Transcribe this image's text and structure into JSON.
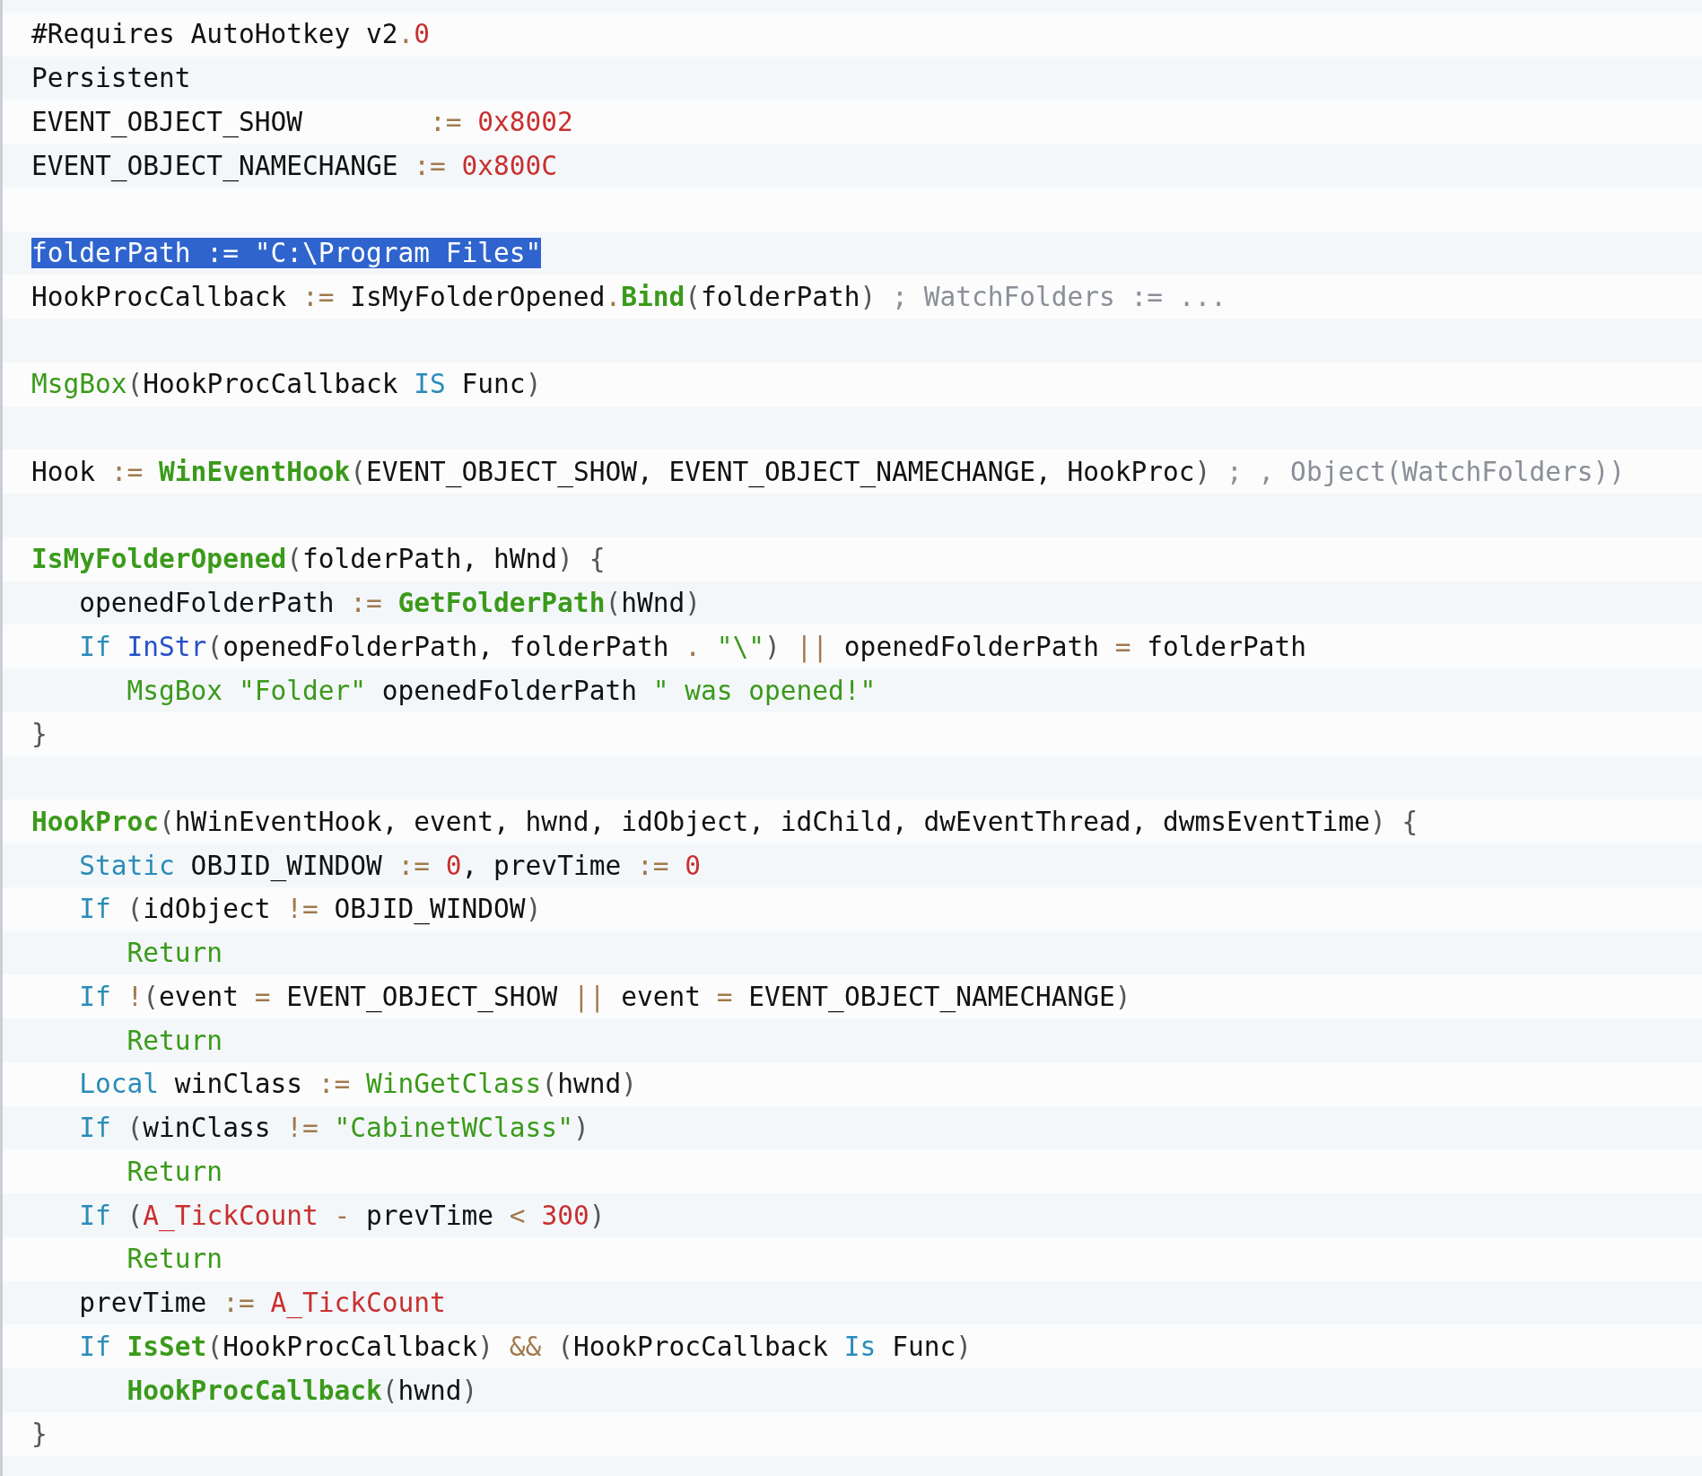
{
  "code": {
    "lines": [
      {
        "kind": "code",
        "tokens": [
          {
            "kind": "t",
            "text": "#Requires AutoHotkey v2"
          },
          {
            "kind": "o",
            "text": "."
          },
          {
            "kind": "n",
            "text": "0"
          }
        ]
      },
      {
        "kind": "code",
        "tokens": [
          {
            "kind": "t",
            "text": "Persistent"
          }
        ]
      },
      {
        "kind": "code",
        "tokens": [
          {
            "kind": "t",
            "text": "EVENT_OBJECT_SHOW       "
          },
          {
            "kind": "o",
            "text": " := "
          },
          {
            "kind": "n",
            "text": "0x8002"
          }
        ]
      },
      {
        "kind": "code",
        "tokens": [
          {
            "kind": "t",
            "text": "EVENT_OBJECT_NAMECHANGE"
          },
          {
            "kind": "o",
            "text": " := "
          },
          {
            "kind": "n",
            "text": "0x800C"
          }
        ]
      },
      {
        "kind": "blank"
      },
      {
        "kind": "code",
        "tokens": [
          {
            "kind": "h",
            "text": "folderPath := \"C:\\Program Files\""
          }
        ]
      },
      {
        "kind": "code",
        "tokens": [
          {
            "kind": "t",
            "text": "HookProcCallback"
          },
          {
            "kind": "o",
            "text": " := "
          },
          {
            "kind": "t",
            "text": "IsMyFolderOpened"
          },
          {
            "kind": "o",
            "text": "."
          },
          {
            "kind": "b",
            "text": "Bind"
          },
          {
            "kind": "p",
            "text": "("
          },
          {
            "kind": "t",
            "text": "folderPath"
          },
          {
            "kind": "p",
            "text": ")"
          },
          {
            "kind": "c",
            "text": " ; WatchFolders := ..."
          }
        ]
      },
      {
        "kind": "blank"
      },
      {
        "kind": "code",
        "tokens": [
          {
            "kind": "f",
            "text": "MsgBox"
          },
          {
            "kind": "p",
            "text": "("
          },
          {
            "kind": "t",
            "text": "HookProcCallback "
          },
          {
            "kind": "k",
            "text": "IS"
          },
          {
            "kind": "t",
            "text": " Func"
          },
          {
            "kind": "p",
            "text": ")"
          }
        ]
      },
      {
        "kind": "blank"
      },
      {
        "kind": "code",
        "tokens": [
          {
            "kind": "t",
            "text": "Hook"
          },
          {
            "kind": "o",
            "text": " := "
          },
          {
            "kind": "b",
            "text": "WinEventHook"
          },
          {
            "kind": "p",
            "text": "("
          },
          {
            "kind": "t",
            "text": "EVENT_OBJECT_SHOW, EVENT_OBJECT_NAMECHANGE, HookProc"
          },
          {
            "kind": "p",
            "text": ")"
          },
          {
            "kind": "c",
            "text": " ; , Object(WatchFolders))"
          }
        ]
      },
      {
        "kind": "blank"
      },
      {
        "kind": "code",
        "tokens": [
          {
            "kind": "b",
            "text": "IsMyFolderOpened"
          },
          {
            "kind": "p",
            "text": "("
          },
          {
            "kind": "t",
            "text": "folderPath, hWnd"
          },
          {
            "kind": "p",
            "text": ") {"
          }
        ],
        "children": [
          {
            "kind": "code",
            "tokens": [
              {
                "kind": "t",
                "text": "openedFolderPath"
              },
              {
                "kind": "o",
                "text": " := "
              },
              {
                "kind": "b",
                "text": "GetFolderPath"
              },
              {
                "kind": "p",
                "text": "("
              },
              {
                "kind": "t",
                "text": "hWnd"
              },
              {
                "kind": "p",
                "text": ")"
              }
            ]
          },
          {
            "kind": "code",
            "tokens": [
              {
                "kind": "k",
                "text": "If "
              },
              {
                "kind": "i",
                "text": "InStr"
              },
              {
                "kind": "p",
                "text": "("
              },
              {
                "kind": "t",
                "text": "openedFolderPath, folderPath"
              },
              {
                "kind": "o",
                "text": " . "
              },
              {
                "kind": "s",
                "text": "\"\\\""
              },
              {
                "kind": "p",
                "text": ")"
              },
              {
                "kind": "o",
                "text": " || "
              },
              {
                "kind": "t",
                "text": "openedFolderPath"
              },
              {
                "kind": "o",
                "text": " = "
              },
              {
                "kind": "t",
                "text": "folderPath"
              }
            ],
            "children": [
              {
                "kind": "code",
                "tokens": [
                  {
                    "kind": "f",
                    "text": "MsgBox"
                  },
                  {
                    "kind": "s",
                    "text": " \"Folder\""
                  },
                  {
                    "kind": "t",
                    "text": " openedFolderPath "
                  },
                  {
                    "kind": "s",
                    "text": "\" was opened!\""
                  }
                ]
              }
            ]
          }
        ]
      },
      {
        "kind": "code",
        "tokens": [
          {
            "kind": "p",
            "text": "}"
          }
        ]
      },
      {
        "kind": "blank"
      },
      {
        "kind": "code",
        "tokens": [
          {
            "kind": "b",
            "text": "HookProc"
          },
          {
            "kind": "p",
            "text": "("
          },
          {
            "kind": "t",
            "text": "hWinEventHook, event, hwnd, idObject, idChild, dwEventThread, dwmsEventTime"
          },
          {
            "kind": "p",
            "text": ") {"
          }
        ],
        "children": [
          {
            "kind": "code",
            "tokens": [
              {
                "kind": "k",
                "text": "Static"
              },
              {
                "kind": "t",
                "text": " OBJID_WINDOW"
              },
              {
                "kind": "o",
                "text": " := "
              },
              {
                "kind": "n",
                "text": "0"
              },
              {
                "kind": "t",
                "text": ", prevTime"
              },
              {
                "kind": "o",
                "text": " := "
              },
              {
                "kind": "n",
                "text": "0"
              }
            ]
          },
          {
            "kind": "code",
            "tokens": [
              {
                "kind": "k",
                "text": "If"
              },
              {
                "kind": "p",
                "text": " ("
              },
              {
                "kind": "t",
                "text": "idObject"
              },
              {
                "kind": "o",
                "text": " != "
              },
              {
                "kind": "t",
                "text": "OBJID_WINDOW"
              },
              {
                "kind": "p",
                "text": ")"
              }
            ],
            "children": [
              {
                "kind": "code",
                "tokens": [
                  {
                    "kind": "f",
                    "text": "Return"
                  }
                ]
              }
            ]
          },
          {
            "kind": "code",
            "tokens": [
              {
                "kind": "k",
                "text": "If"
              },
              {
                "kind": "o",
                "text": " !"
              },
              {
                "kind": "p",
                "text": "("
              },
              {
                "kind": "t",
                "text": "event"
              },
              {
                "kind": "o",
                "text": " = "
              },
              {
                "kind": "t",
                "text": "EVENT_OBJECT_SHOW"
              },
              {
                "kind": "o",
                "text": " || "
              },
              {
                "kind": "t",
                "text": "event"
              },
              {
                "kind": "o",
                "text": " = "
              },
              {
                "kind": "t",
                "text": "EVENT_OBJECT_NAMECHANGE"
              },
              {
                "kind": "p",
                "text": ")"
              }
            ],
            "children": [
              {
                "kind": "code",
                "tokens": [
                  {
                    "kind": "f",
                    "text": "Return"
                  }
                ]
              }
            ]
          },
          {
            "kind": "code",
            "tokens": [
              {
                "kind": "k",
                "text": "Local"
              },
              {
                "kind": "t",
                "text": " winClass"
              },
              {
                "kind": "o",
                "text": " := "
              },
              {
                "kind": "f",
                "text": "WinGetClass"
              },
              {
                "kind": "p",
                "text": "("
              },
              {
                "kind": "t",
                "text": "hwnd"
              },
              {
                "kind": "p",
                "text": ")"
              }
            ]
          },
          {
            "kind": "code",
            "tokens": [
              {
                "kind": "k",
                "text": "If"
              },
              {
                "kind": "p",
                "text": " ("
              },
              {
                "kind": "t",
                "text": "winClass"
              },
              {
                "kind": "o",
                "text": " != "
              },
              {
                "kind": "s",
                "text": "\"CabinetWClass\""
              },
              {
                "kind": "p",
                "text": ")"
              }
            ],
            "children": [
              {
                "kind": "code",
                "tokens": [
                  {
                    "kind": "f",
                    "text": "Return"
                  }
                ]
              }
            ]
          },
          {
            "kind": "code",
            "tokens": [
              {
                "kind": "k",
                "text": "If"
              },
              {
                "kind": "p",
                "text": " ("
              },
              {
                "kind": "n",
                "text": "A_TickCount"
              },
              {
                "kind": "o",
                "text": " - "
              },
              {
                "kind": "t",
                "text": "prevTime"
              },
              {
                "kind": "o",
                "text": " < "
              },
              {
                "kind": "n",
                "text": "300"
              },
              {
                "kind": "p",
                "text": ")"
              }
            ],
            "children": [
              {
                "kind": "code",
                "tokens": [
                  {
                    "kind": "f",
                    "text": "Return"
                  }
                ]
              }
            ]
          },
          {
            "kind": "code",
            "tokens": [
              {
                "kind": "t",
                "text": "prevTime"
              },
              {
                "kind": "o",
                "text": " := "
              },
              {
                "kind": "n",
                "text": "A_TickCount"
              }
            ]
          },
          {
            "kind": "code",
            "tokens": [
              {
                "kind": "k",
                "text": "If "
              },
              {
                "kind": "b",
                "text": "IsSet"
              },
              {
                "kind": "p",
                "text": "("
              },
              {
                "kind": "t",
                "text": "HookProcCallback"
              },
              {
                "kind": "p",
                "text": ")"
              },
              {
                "kind": "o",
                "text": " && "
              },
              {
                "kind": "p",
                "text": "("
              },
              {
                "kind": "t",
                "text": "HookProcCallback "
              },
              {
                "kind": "k",
                "text": "Is"
              },
              {
                "kind": "t",
                "text": " Func"
              },
              {
                "kind": "p",
                "text": ")"
              }
            ],
            "children": [
              {
                "kind": "code",
                "tokens": [
                  {
                    "kind": "b",
                    "text": "HookProcCallback"
                  },
                  {
                    "kind": "p",
                    "text": "("
                  },
                  {
                    "kind": "t",
                    "text": "hwnd"
                  },
                  {
                    "kind": "p",
                    "text": ")"
                  }
                ]
              }
            ]
          }
        ]
      },
      {
        "kind": "code",
        "tokens": [
          {
            "kind": "p",
            "text": "}"
          }
        ]
      }
    ]
  }
}
